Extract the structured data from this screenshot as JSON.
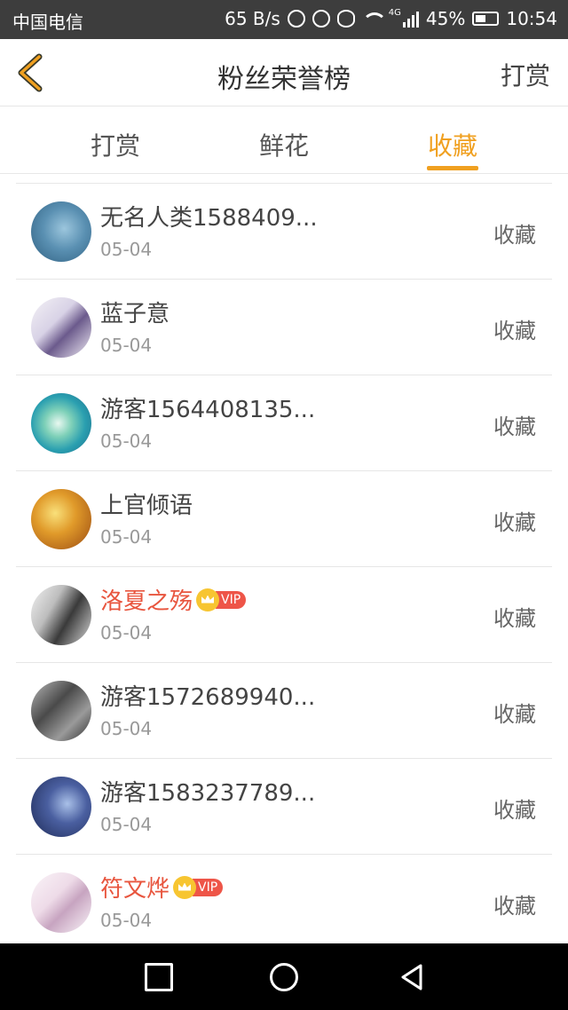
{
  "status_bar": {
    "carrier": "中国电信",
    "net_speed": "65 B/s",
    "battery": "45%",
    "time": "10:54",
    "network": "4G"
  },
  "header": {
    "title": "粉丝荣誉榜",
    "action": "打赏",
    "back_icon": "chevron-left-icon",
    "back_color": "#f0a020"
  },
  "tabs": [
    {
      "label": "打赏",
      "active": false
    },
    {
      "label": "鲜花",
      "active": false
    },
    {
      "label": "收藏",
      "active": true
    }
  ],
  "accent_color": "#f0a020",
  "list": [
    {
      "name": "无名人类1588409...",
      "date": "05-04",
      "action": "收藏",
      "vip": false
    },
    {
      "name": "蓝子意",
      "date": "05-04",
      "action": "收藏",
      "vip": false
    },
    {
      "name": "游客1564408135...",
      "date": "05-04",
      "action": "收藏",
      "vip": false
    },
    {
      "name": "上官倾语",
      "date": "05-04",
      "action": "收藏",
      "vip": false
    },
    {
      "name": "洛夏之殇",
      "date": "05-04",
      "action": "收藏",
      "vip": true,
      "vip_label": "VIP"
    },
    {
      "name": "游客1572689940...",
      "date": "05-04",
      "action": "收藏",
      "vip": false
    },
    {
      "name": "游客1583237789...",
      "date": "05-04",
      "action": "收藏",
      "vip": false
    },
    {
      "name": "符文烨",
      "date": "05-04",
      "action": "收藏",
      "vip": true,
      "vip_label": "VIP"
    }
  ]
}
